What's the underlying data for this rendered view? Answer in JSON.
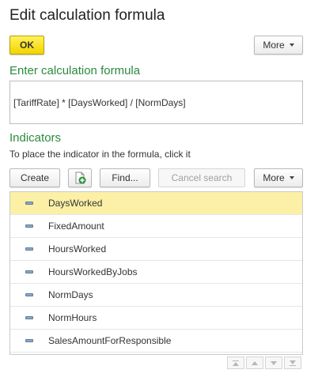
{
  "window": {
    "title": "Edit calculation formula"
  },
  "toolbar": {
    "ok_label": "OK",
    "more_label": "More"
  },
  "formula": {
    "section_label": "Enter calculation formula",
    "value": "[TariffRate] * [DaysWorked] / [NormDays]"
  },
  "indicators": {
    "section_label": "Indicators",
    "hint": "To place the indicator in the formula, click it",
    "buttons": {
      "create": "Create",
      "find": "Find...",
      "cancel_search": "Cancel search",
      "more": "More"
    },
    "items": [
      {
        "label": "DaysWorked",
        "selected": true
      },
      {
        "label": "FixedAmount"
      },
      {
        "label": "HoursWorked"
      },
      {
        "label": "HoursWorkedByJobs"
      },
      {
        "label": "NormDays"
      },
      {
        "label": "NormHours"
      },
      {
        "label": "SalesAmountForResponsible"
      }
    ]
  },
  "icons": {
    "add_copy": "add-copy-icon",
    "row_item": "indicator-item-icon",
    "nav_first": "move-first-icon",
    "nav_up": "move-up-icon",
    "nav_down": "move-down-icon",
    "nav_last": "move-last-icon"
  },
  "colors": {
    "accent": "#2b8a3e",
    "ok": "#f2d400",
    "selection": "#fbf0a6"
  }
}
